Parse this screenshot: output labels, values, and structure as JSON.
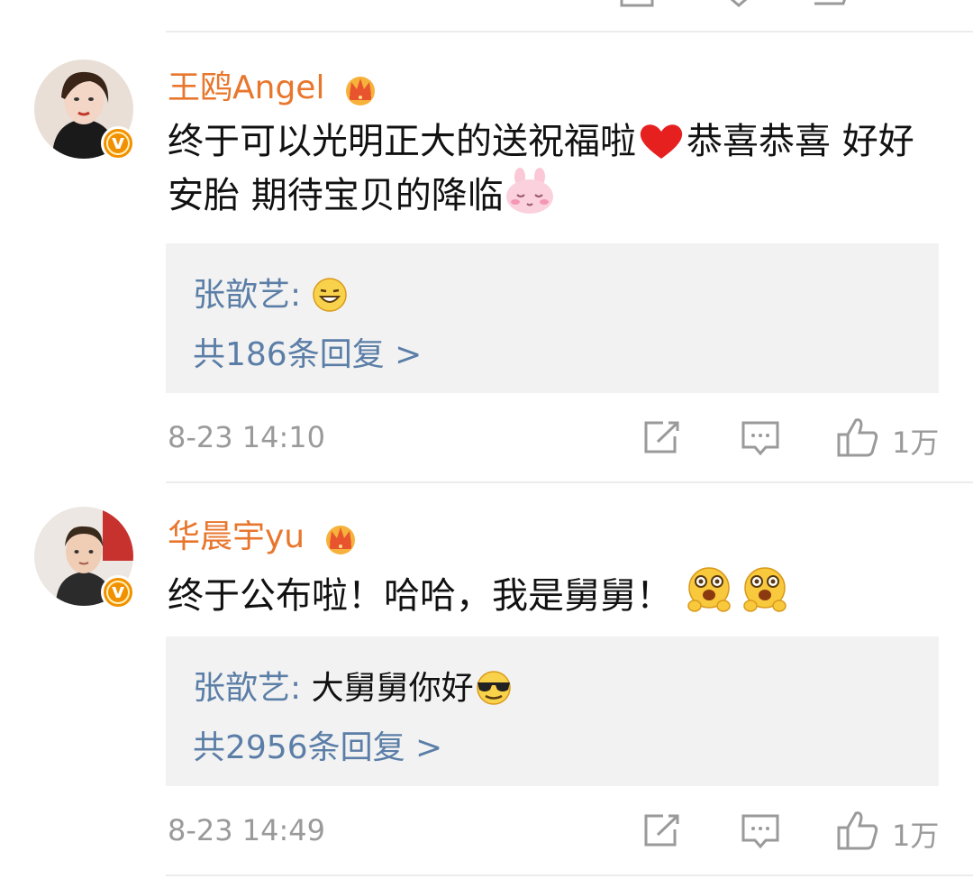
{
  "comments": [
    {
      "username": "王鸥Angel",
      "text": "终于可以光明正大的送祝福啦",
      "text_after_heart": "恭喜恭喜 好好安胎 期待宝贝的降临",
      "reply": {
        "author": "张歆艺:",
        "text": ""
      },
      "reply_count": "共186条回复 >",
      "time": "8-23 14:10",
      "likes": "1万"
    },
    {
      "username": "华晨宇yu",
      "text": "终于公布啦！哈哈，我是舅舅！",
      "reply": {
        "author": "张歆艺:",
        "text": " 大舅舅你好"
      },
      "reply_count": "共2956条回复 >",
      "time": "8-23 14:49",
      "likes": "1万"
    }
  ],
  "colors": {
    "username": "#e8762d",
    "link": "#5b7ea7",
    "meta": "#9a9a9a",
    "reply_bg": "#f2f2f2",
    "verified_badge": "#f29100"
  },
  "icons": [
    "share-icon",
    "comment-icon",
    "like-icon",
    "crown-icon",
    "verified-icon",
    "heart-emoji",
    "bunny-emoji",
    "grin-emoji",
    "surprised-emoji",
    "sunglasses-emoji"
  ]
}
